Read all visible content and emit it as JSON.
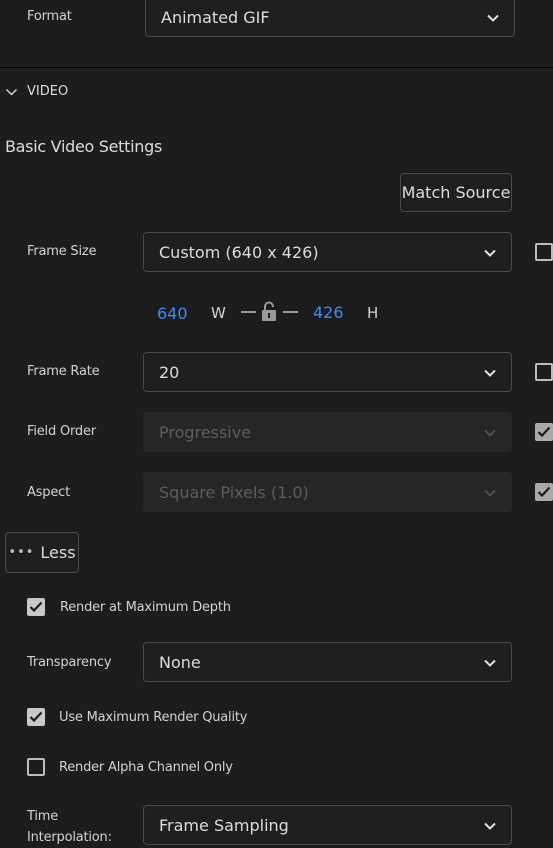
{
  "format": {
    "label": "Format",
    "value": "Animated GIF"
  },
  "video_section": {
    "title": "VIDEO",
    "subheading": "Basic Video Settings"
  },
  "match_source_label": "Match Source",
  "frame_size": {
    "label": "Frame Size",
    "value": "Custom (640 x 426)",
    "linked_checked": false
  },
  "dimensions": {
    "width": "640",
    "width_unit": "W",
    "height": "426",
    "height_unit": "H"
  },
  "frame_rate": {
    "label": "Frame Rate",
    "value": "20",
    "linked_checked": false
  },
  "field_order": {
    "label": "Field Order",
    "value": "Progressive",
    "linked_checked": true
  },
  "aspect": {
    "label": "Aspect",
    "value": "Square Pixels (1.0)",
    "linked_checked": true
  },
  "less_button": {
    "icon": "ellipsis-icon",
    "label": "Less"
  },
  "render_max_depth": {
    "label": "Render at Maximum Depth",
    "checked": true
  },
  "transparency": {
    "label": "Transparency",
    "value": "None"
  },
  "max_render_quality": {
    "label": "Use Maximum Render Quality",
    "checked": true
  },
  "alpha_only": {
    "label": "Render Alpha Channel Only",
    "checked": false
  },
  "time_interpolation": {
    "label_line1": "Time",
    "label_line2": "Interpolation:",
    "value": "Frame Sampling"
  },
  "colors": {
    "accent": "#3b8bf5",
    "background": "#1d1d1d",
    "border": "#4a4a4a"
  }
}
